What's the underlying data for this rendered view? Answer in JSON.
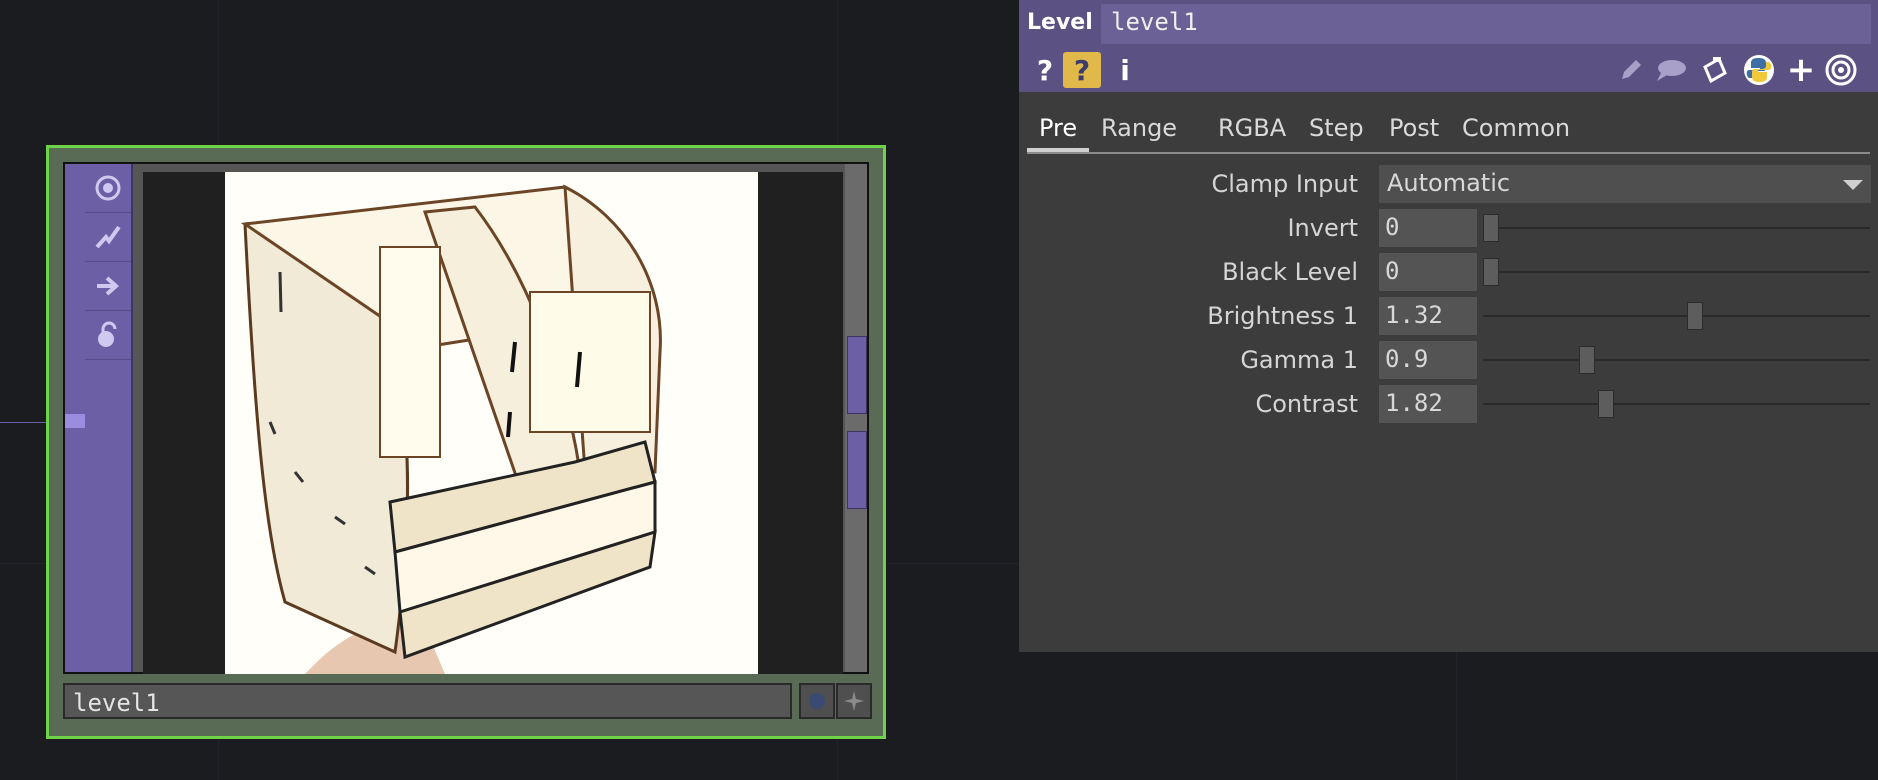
{
  "node": {
    "name": "level1",
    "tool_icons": [
      "target-icon",
      "pulse-icon",
      "arrow-right-icon",
      "lock-icon"
    ],
    "output_buttons": [
      "viewer-dot-icon",
      "pin-icon"
    ]
  },
  "panel": {
    "op_type": "Level",
    "op_name": "level1",
    "toolbar_left": [
      "help-icon",
      "python-help-icon",
      "info-icon"
    ],
    "toolbar_right": [
      "edit-icon",
      "comment-icon",
      "clipboard-icon",
      "python-icon",
      "add-icon",
      "target-icon"
    ],
    "tabs": [
      {
        "label": "Pre",
        "active": true
      },
      {
        "label": "Range",
        "active": false
      },
      {
        "label": "RGBA",
        "active": false
      },
      {
        "label": "Step",
        "active": false
      },
      {
        "label": "Post",
        "active": false
      },
      {
        "label": "Common",
        "active": false
      }
    ],
    "params": {
      "clamp_input": {
        "label": "Clamp Input",
        "value": "Automatic"
      },
      "invert": {
        "label": "Invert",
        "value": "0",
        "slider_fraction": 0.0
      },
      "black_level": {
        "label": "Black Level",
        "value": "0",
        "slider_fraction": 0.0
      },
      "brightness1": {
        "label": "Brightness 1",
        "value": "1.32",
        "slider_fraction": 0.55
      },
      "gamma1": {
        "label": "Gamma 1",
        "value": "0.9",
        "slider_fraction": 0.26
      },
      "contrast": {
        "label": "Contrast",
        "value": "1.82",
        "slider_fraction": 0.31
      }
    }
  },
  "colors": {
    "background": "#1b1c20",
    "node_selected_border": "#6fd34a",
    "panel_header": "#5b5182",
    "input_connector": "#6d5fa5"
  }
}
